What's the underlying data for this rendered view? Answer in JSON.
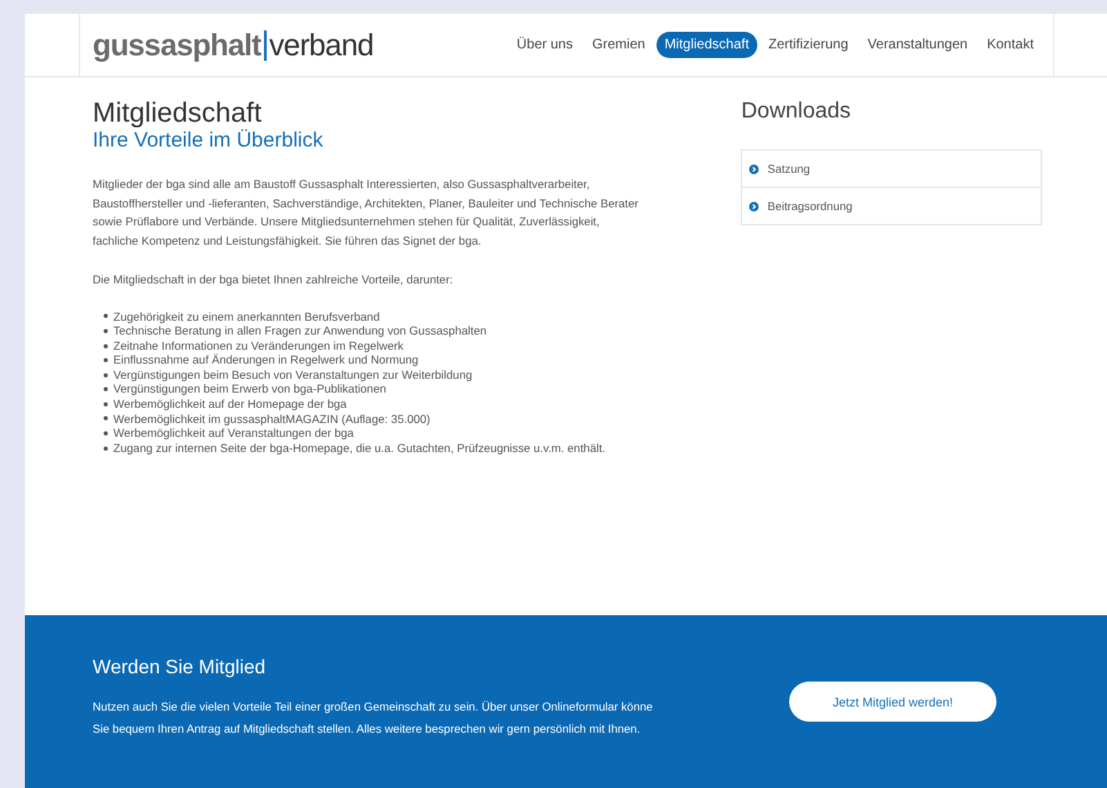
{
  "header": {
    "logo": {
      "part_1": "gussasphalt",
      "part_2": "verband"
    },
    "nav": [
      {
        "label": "Über uns",
        "selected": false
      },
      {
        "label": "Gremien",
        "selected": false
      },
      {
        "label": "Mitgliedschaft",
        "selected": true
      },
      {
        "label": "Zertifizierung",
        "selected": false
      },
      {
        "label": "Veranstaltungen",
        "selected": false
      },
      {
        "label": "Kontakt",
        "selected": false
      }
    ]
  },
  "main": {
    "title": "Mitgliedschaft",
    "subtitle": "Ihre Vorteile im Überblick",
    "paragraphs": [
      "Mitglieder der bga sind alle am Baustoff Gussasphalt Interessierten, also Gussasphaltverarbeiter, Baustoffhersteller und -lieferanten, Sachverständige, Architekten, Planer, Bauleiter und Technische Berater sowie Prüflabore und Verbände. Unsere Mitgliedsunternehmen stehen für Qualität, Zuverlässigkeit, fachliche Kompetenz und Leistungsfähigkeit. Sie führen das Signet der bga.",
      "Die Mitgliedschaft in der bga bietet Ihnen zahlreiche Vorteile, darunter:"
    ],
    "benefits": [
      "Zugehörigkeit zu einem anerkannten Berufsverband",
      "Technische Beratung in allen Fragen zur Anwendung von Gussasphalten",
      "Zeitnahe Informationen zu Veränderungen im Regelwerk",
      "Einflussnahme auf Änderungen in Regelwerk und Normung",
      "Vergünstigungen beim Besuch von Veranstaltungen zur Weiterbildung",
      "Vergünstigungen beim Erwerb von bga-Publikationen",
      "Werbemöglichkeit auf der Homepage der bga",
      "Werbemöglichkeit im gussasphaltMAGAZIN (Auflage: 35.000)",
      "Werbemöglichkeit auf Veranstaltungen der bga",
      "Zugang zur internen Seite der bga-Homepage, die u.a. Gutachten, Prüfzeugnisse u.v.m. enthält."
    ]
  },
  "downloads": {
    "title": "Downloads",
    "items": [
      "Satzung",
      "Beitragsordnung"
    ]
  },
  "cta": {
    "title": "Werden Sie Mitglied",
    "text": "Nutzen auch Sie die vielen Vorteile Teil einer großen Gemeinschaft zu sein. Über unser Onlineformular könne Sie bequem Ihren Antrag auf Mitgliedschaft stellen. Alles weitere besprechen wir gern persönlich mit Ihnen.",
    "button": "Jetzt Mitglied werden!"
  }
}
